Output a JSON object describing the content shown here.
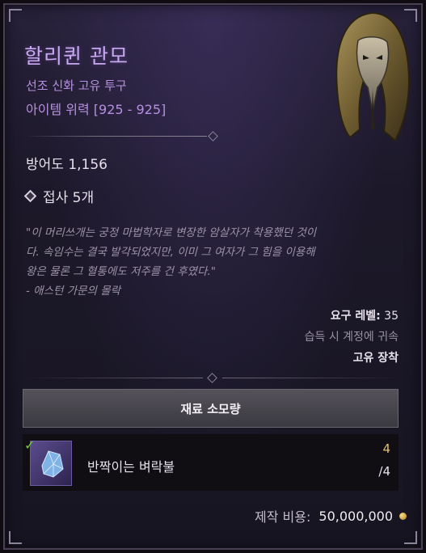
{
  "item": {
    "name": "할리퀸 관모",
    "type": "선조 신화 고유 투구",
    "power": "아이템 위력 [925 - 925]",
    "icon": "helmet-icon"
  },
  "stats": {
    "armor": "방어도 1,156",
    "sockets": "접사 5개"
  },
  "flavor": {
    "lines": [
      "\"이 머리쓰개는 궁정 마법학자로 변장한 암살자가 착용했던 것이",
      "다. 속임수는 결국 발각되었지만, 이미 그 여자가 그 힘을 이용해",
      "왕은 물론 그 혈통에도 저주를 건 후였다.\""
    ],
    "source": "- 애스턴 가문의 몰락"
  },
  "requirements": {
    "level_label": "요구 레벨:",
    "level_value": "35",
    "bind": "습득 시 계정에 귀속",
    "equip": "고유 장착"
  },
  "materials": {
    "header": "재료 소모량",
    "items": [
      {
        "name": "반짝이는 벼락불",
        "have": "4",
        "need": "/4",
        "icon": "crystal-icon",
        "status_icon": "checkmark-icon"
      }
    ]
  },
  "cost": {
    "label": "제작 비용:",
    "value": "50,000,000",
    "icon": "gold-coin-icon"
  },
  "colors": {
    "mythic_purple": "#c8a8f0",
    "quantity_gold": "#e4c070",
    "check_green": "#6cd030"
  }
}
